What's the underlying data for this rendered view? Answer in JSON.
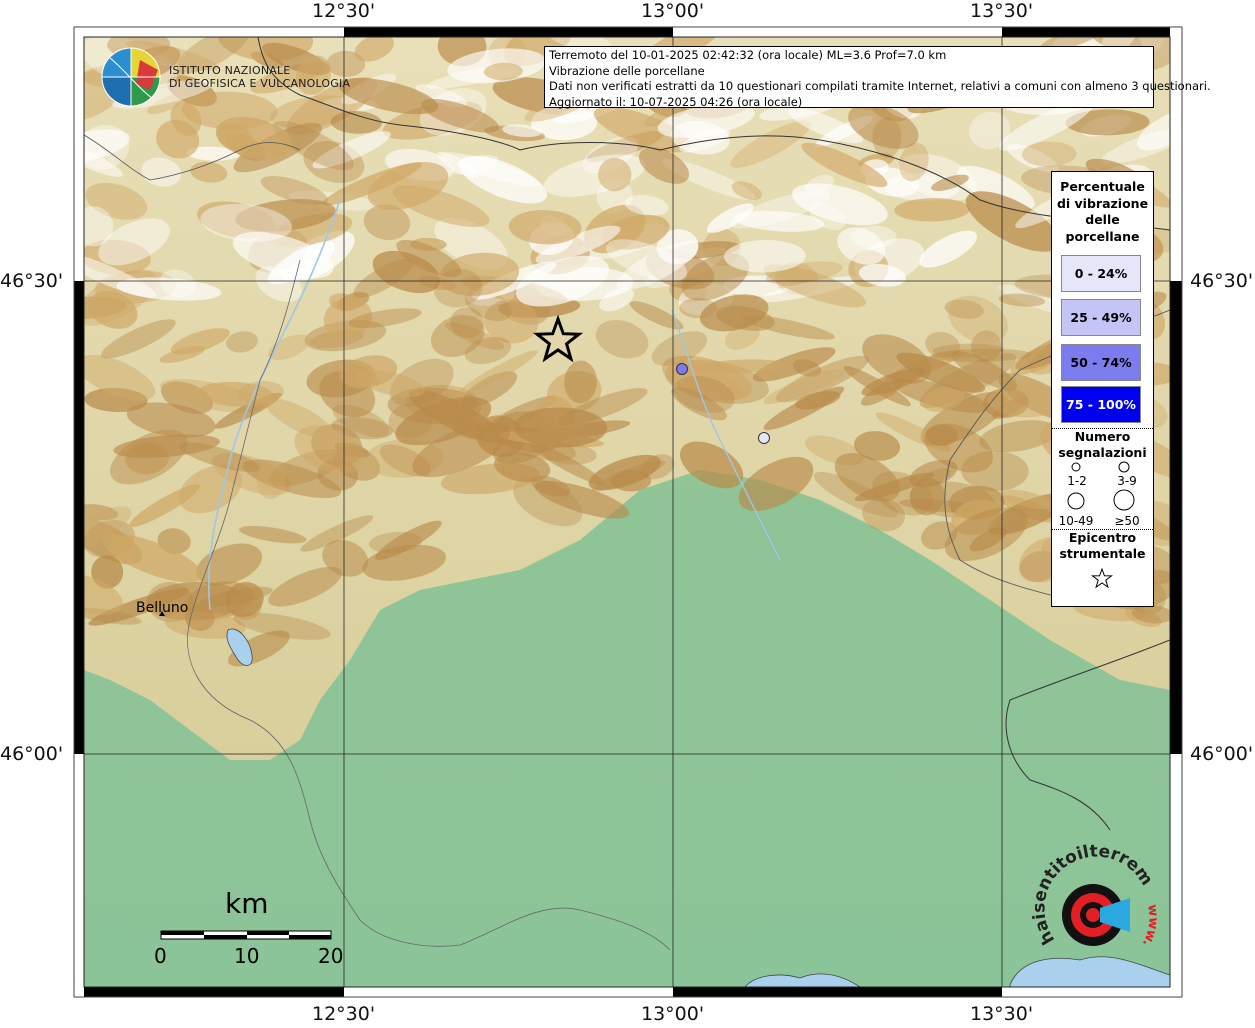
{
  "map": {
    "lon_labels": [
      "12°30'",
      "13°00'",
      "13°30'"
    ],
    "lat_labels": [
      "46°30'",
      "46°00'"
    ],
    "place_labels": [
      {
        "name": "Belluno"
      }
    ]
  },
  "logo": {
    "line1": "ISTITUTO NAZIONALE",
    "line2": "DI GEOFISICA E VULCANOLOGIA"
  },
  "info": {
    "line1": "Terremoto del 10-01-2025 02:42:32 (ora locale) ML=3.6 Prof=7.0 km",
    "line2": "Vibrazione delle porcellane",
    "line3": "Dati non verificati estratti da 10 questionari compilati tramite Internet, relativi a comuni con almeno 3 questionari.",
    "line4": "Aggiornato il: 10-07-2025 04:26 (ora locale)"
  },
  "legend": {
    "title": "Percentuale di vibrazione delle porcellane",
    "classes": [
      {
        "label": "0 - 24%",
        "color": "#e6e6fa"
      },
      {
        "label": "25 - 49%",
        "color": "#c4c4f6"
      },
      {
        "label": "50 - 74%",
        "color": "#7c7cef"
      },
      {
        "label": "75 - 100%",
        "color": "#0000f0"
      }
    ],
    "count_title": "Numero segnalazioni",
    "count_classes": [
      "1-2",
      "3-9",
      "10-49",
      "≥50"
    ],
    "epicenter_title": "Epicentro strumentale"
  },
  "points": [
    {
      "name": "epicenter",
      "lon": 12.95,
      "lat": 46.44,
      "icon": "star-icon"
    },
    {
      "name": "report-1",
      "lon": 13.02,
      "lat": 46.41,
      "class": "50 - 74%"
    },
    {
      "name": "report-2",
      "lon": 13.14,
      "lat": 46.34,
      "class": "0 - 24%"
    }
  ],
  "scale": {
    "title": "km",
    "ticks": [
      "0",
      "10",
      "20"
    ]
  },
  "brand": {
    "text": "haisentitoilterremoto.it",
    "url_text": "www."
  }
}
